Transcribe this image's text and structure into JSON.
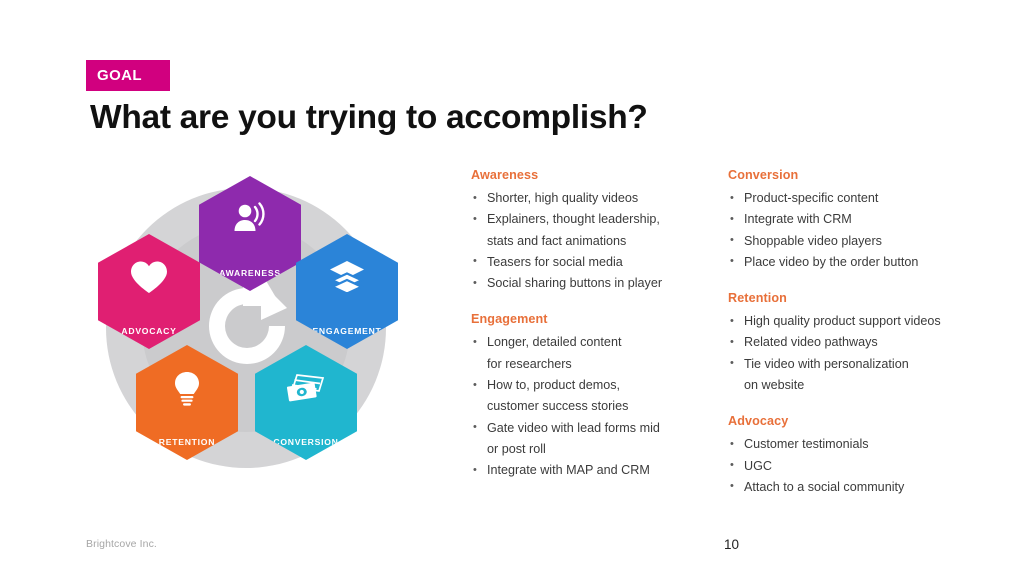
{
  "header": {
    "badge_label": "GOAL",
    "badge_color": "#d1007f",
    "title": "What are you trying to accomplish?"
  },
  "diagram": {
    "name": "customer-lifecycle-hexagon-wheel",
    "center_icon": "refresh-cycle-icon",
    "nodes": [
      {
        "label": "AWARENESS",
        "color": "#8e2aad",
        "icon": "person-broadcast-icon"
      },
      {
        "label": "ENGAGEMENT",
        "color": "#2b84d8",
        "icon": "layers-stack-icon"
      },
      {
        "label": "CONVERSION",
        "color": "#20b6cf",
        "icon": "money-bills-icon"
      },
      {
        "label": "RETENTION",
        "color": "#ef6c24",
        "icon": "lightbulb-icon"
      },
      {
        "label": "ADVOCACY",
        "color": "#e01f72",
        "icon": "heart-icon"
      }
    ]
  },
  "columns": {
    "left": [
      {
        "title": "Awareness",
        "bullets": [
          [
            "Shorter, high quality videos"
          ],
          [
            "Explainers, thought leadership,",
            "stats and fact animations"
          ],
          [
            "Teasers for social media"
          ],
          [
            "Social sharing buttons in player"
          ]
        ]
      },
      {
        "title": "Engagement",
        "bullets": [
          [
            "Longer, detailed content",
            "for researchers"
          ],
          [
            "How to, product demos,",
            "customer success stories"
          ],
          [
            "Gate video with lead forms mid",
            "or post roll"
          ],
          [
            "Integrate with MAP and CRM"
          ]
        ]
      }
    ],
    "right": [
      {
        "title": "Conversion",
        "bullets": [
          [
            "Product-specific content"
          ],
          [
            "Integrate with CRM"
          ],
          [
            "Shoppable video players"
          ],
          [
            "Place video by the order button"
          ]
        ]
      },
      {
        "title": "Retention",
        "bullets": [
          [
            "High quality product support videos"
          ],
          [
            "Related video pathways"
          ],
          [
            "Tie video with personalization",
            "on website"
          ]
        ]
      },
      {
        "title": "Advocacy",
        "bullets": [
          [
            "Customer testimonials"
          ],
          [
            "UGC"
          ],
          [
            "Attach to a social community"
          ]
        ]
      }
    ]
  },
  "footer": {
    "brand": "Brightcove Inc.",
    "page_number": "10"
  },
  "colors": {
    "accent_orange": "#e8703a",
    "body_text": "#3b3b3b",
    "title_text": "#111111"
  }
}
